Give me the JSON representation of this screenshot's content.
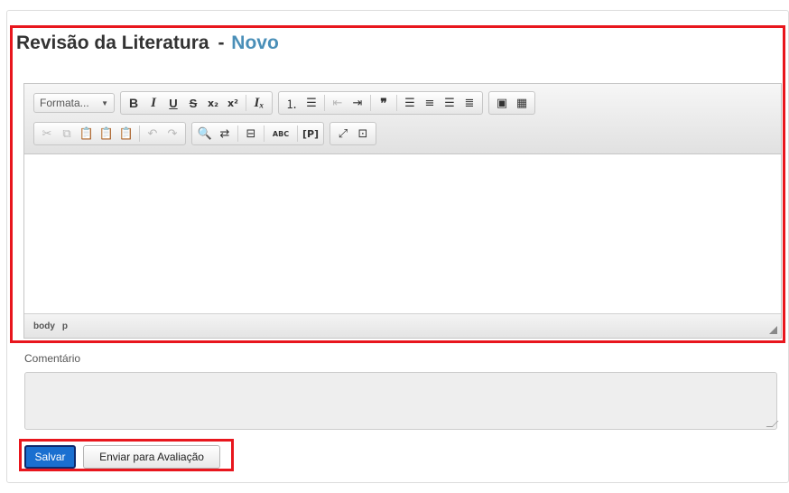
{
  "page": {
    "title": "Revisão da Literatura",
    "separator": "-",
    "status": "Novo"
  },
  "editor": {
    "format_combo": "Formata...",
    "toolbar_row1": {
      "bold": "B",
      "italic": "I",
      "underline": "U",
      "strike": "S",
      "subscript": "x₂",
      "superscript": "x²",
      "remove_format": "Iₓ",
      "numbered_list": "⒈",
      "bulleted_list": "☰",
      "outdent": "⇤",
      "indent": "⇥",
      "blockquote": "❞",
      "align_left": "☰",
      "align_center": "≡",
      "align_right": "☰",
      "justify": "≣",
      "image": "▣",
      "table": "▦"
    },
    "toolbar_row2": {
      "cut": "✂",
      "copy": "⧉",
      "paste": "📋",
      "paste_text": "📋",
      "paste_word": "📋",
      "undo": "↶",
      "redo": "↷",
      "find": "🔍",
      "replace": "⇄",
      "page_break": "⊟",
      "spellcheck": "ABC",
      "show_blocks": "[P]",
      "maximize": "⤢",
      "source": "⊡"
    },
    "statusbar_path": [
      "body",
      "p"
    ]
  },
  "comment": {
    "label": "Comentário",
    "value": ""
  },
  "actions": {
    "save_label": "Salvar",
    "submit_label": "Enviar para Avaliação"
  },
  "colors": {
    "highlight": "#e8161d",
    "status": "#4a8fb8",
    "primary_button": "#1a6fd0"
  }
}
